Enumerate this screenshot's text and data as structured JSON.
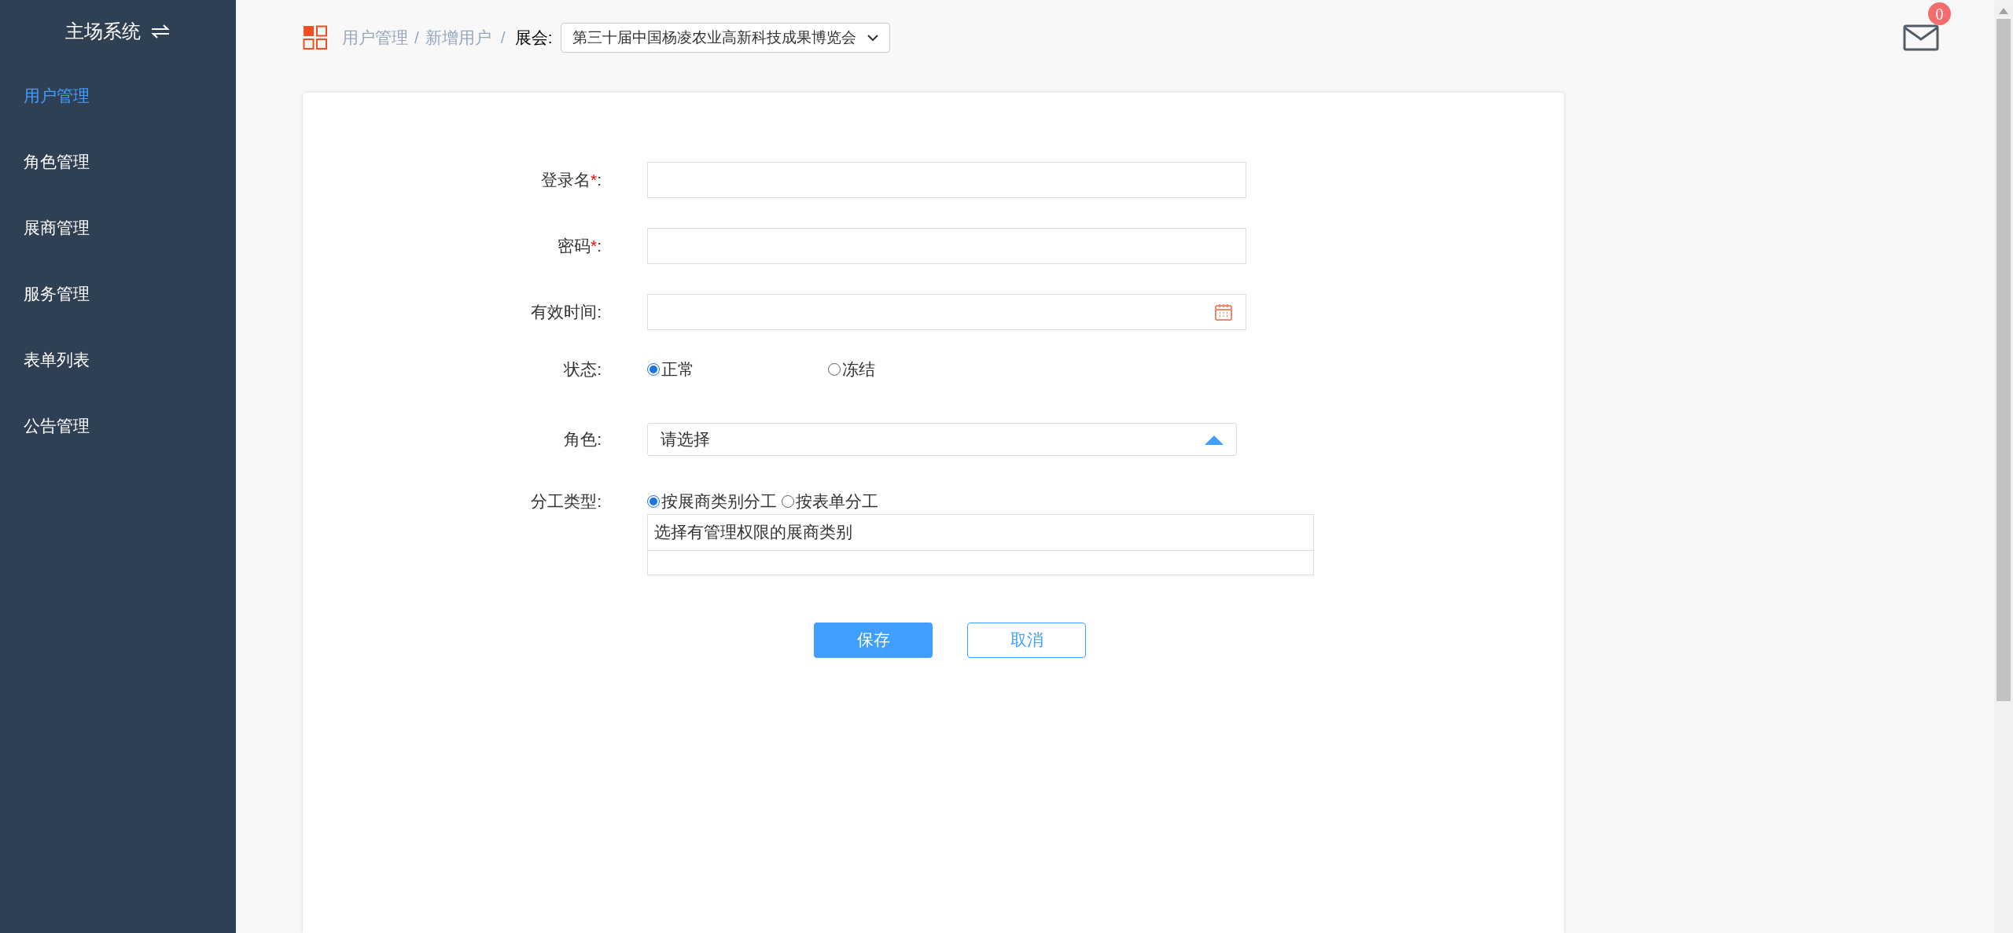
{
  "sidebar": {
    "title": "主场系统",
    "items": [
      {
        "label": "用户管理",
        "selected": true
      },
      {
        "label": "角色管理",
        "selected": false
      },
      {
        "label": "展商管理",
        "selected": false
      },
      {
        "label": "服务管理",
        "selected": false
      },
      {
        "label": "表单列表",
        "selected": false
      },
      {
        "label": "公告管理",
        "selected": false
      }
    ]
  },
  "breadcrumb": {
    "items": [
      "用户管理",
      "新增用户"
    ],
    "separators": [
      "/",
      "/"
    ]
  },
  "expo": {
    "label": "展会:",
    "value": "第三十届中国杨凌农业高新科技成果博览会"
  },
  "messages": {
    "count": "0"
  },
  "form": {
    "login_name": {
      "label": "登录名",
      "required_mark": "*",
      "colon": ":"
    },
    "password": {
      "label": "密码",
      "required_mark": "*",
      "colon": ":"
    },
    "valid_time": {
      "label": "有效时间:"
    },
    "status": {
      "label": "状态:",
      "options": [
        {
          "label": "正常",
          "selected": true
        },
        {
          "label": "冻结",
          "selected": false
        }
      ]
    },
    "role": {
      "label": "角色:",
      "placeholder": "请选择"
    },
    "division": {
      "label": "分工类型:",
      "options": [
        {
          "label": "按展商类别分工",
          "selected": true
        },
        {
          "label": "按表单分工",
          "selected": false
        }
      ],
      "table_header": "选择有管理权限的展商类别"
    },
    "buttons": {
      "save": "保存",
      "cancel": "取消"
    }
  }
}
